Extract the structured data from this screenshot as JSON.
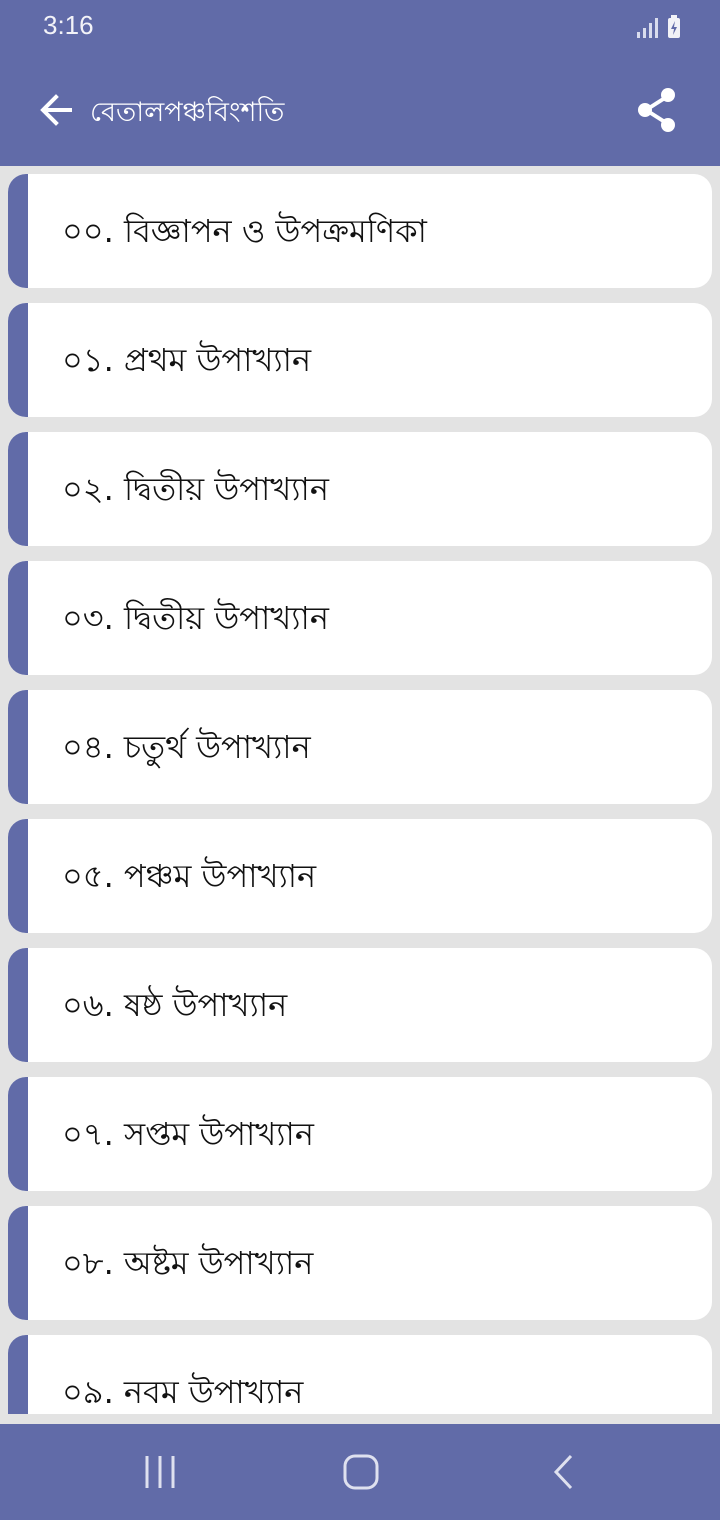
{
  "status_bar": {
    "time": "3:16",
    "icons": [
      "signal-icon",
      "battery-charging-icon"
    ]
  },
  "app_bar": {
    "title": "বেতালপঞ্চবিংশতি",
    "back_icon": "arrow-left-icon",
    "share_icon": "share-icon"
  },
  "chapters": [
    {
      "label": "০০. বিজ্ঞাপন ও উপক্রমণিকা"
    },
    {
      "label": "০১. প্রথম উপাখ্যান"
    },
    {
      "label": "০২. দ্বিতীয় উপাখ্যান"
    },
    {
      "label": "০৩. দ্বিতীয় উপাখ্যান"
    },
    {
      "label": "০৪. চতুর্থ উপাখ্যান"
    },
    {
      "label": "০৫. পঞ্চম উপাখ্যান"
    },
    {
      "label": "০৬. ষষ্ঠ উপাখ্যান"
    },
    {
      "label": "০৭. সপ্তম উপাখ্যান"
    },
    {
      "label": "০৮. অষ্টম উপাখ্যান"
    },
    {
      "label": "০৯. নবম উপাখ্যান"
    }
  ],
  "nav_bar": {
    "icons": [
      "recent-apps-icon",
      "home-icon",
      "back-icon"
    ]
  },
  "colors": {
    "primary": "#616ba8",
    "background": "#e3e3e3",
    "card": "#ffffff"
  }
}
